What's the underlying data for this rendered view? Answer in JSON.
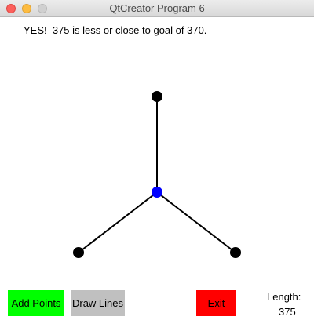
{
  "window": {
    "title": "QtCreator Program 6"
  },
  "status": {
    "message": "YES!  375 is less or close to goal of 370."
  },
  "buttons": {
    "add_points": "Add Points",
    "draw_lines": "Draw Lines",
    "exit": "Exit"
  },
  "length": {
    "label": "Length:",
    "value": "375"
  },
  "colors": {
    "add_points_bg": "#00ff00",
    "draw_lines_bg": "#c0c0c0",
    "exit_bg": "#ff0000",
    "point_fill": "#000000",
    "center_point_fill": "#0000ff",
    "line_color": "#000000"
  }
}
